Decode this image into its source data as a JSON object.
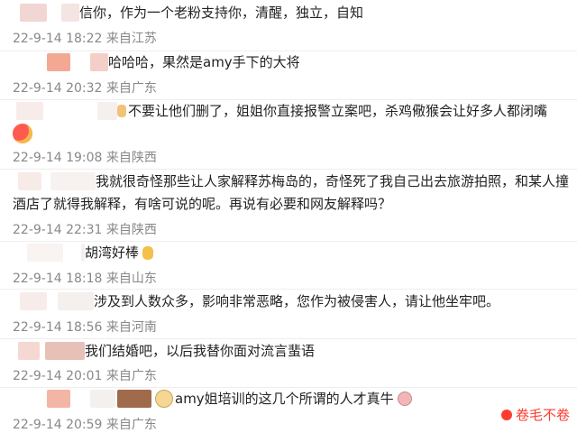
{
  "comments": [
    {
      "text": "信你，作为一个老粉支持你，清醒，独立，自知",
      "time": "22-9-14 18:22",
      "location": "来自江苏"
    },
    {
      "text": "哈哈哈，果然是amy手下的大将",
      "time": "22-9-14 20:32",
      "location": "来自广东"
    },
    {
      "text": "不要让他们删了，姐姐你直接报警立案吧，杀鸡儆猴会让好多人都闭嘴",
      "time": "22-9-14 19:08",
      "location": "来自陕西"
    },
    {
      "text_line1": "我就很奇怪那些让人家解释苏梅岛的，奇怪死了我自己出去旅游拍照，和某人撞",
      "text_line2": "酒店了就得我解释，有啥可说的呢。再说有必要和网友解释吗？",
      "time": "22-9-14 22:31",
      "location": "来自陕西"
    },
    {
      "text": "胡湾好棒",
      "time": "22-9-14 18:18",
      "location": "来自山东"
    },
    {
      "text": "涉及到人数众多，影响非常恶略，您作为被侵害人，请让他坐牢吧。",
      "time": "22-9-14 18:56",
      "location": "来自河南"
    },
    {
      "text": "我们结婚吧，以后我替你面对流言蜚语",
      "time": "22-9-14 20:01",
      "location": "来自广东"
    },
    {
      "text": "amy姐培训的这几个所谓的人才真牛",
      "time": "22-9-14 20:59",
      "location": "来自广东"
    }
  ],
  "watermark": {
    "text": "卷毛不卷"
  },
  "colors": {
    "meta": "#888888",
    "text": "#222222",
    "watermark": "#ff3b30"
  }
}
